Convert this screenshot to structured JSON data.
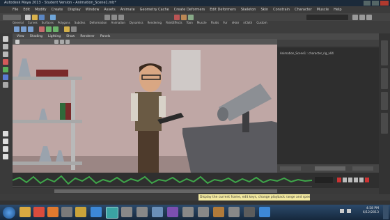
{
  "window": {
    "title": "Autodesk Maya 2013 - Student Version - Animation_Scene1.mb*"
  },
  "menubar": {
    "items": [
      "File",
      "Edit",
      "Modify",
      "Create",
      "Display",
      "Window",
      "Assets",
      "Animate",
      "Geometry Cache",
      "Create Deformers",
      "Edit Deformers",
      "Skeleton",
      "Skin",
      "Constrain",
      "Character",
      "Muscle",
      "Help"
    ]
  },
  "shelf": {
    "tabs": [
      "General",
      "Curves",
      "Surfaces",
      "Polygons",
      "Subdivs",
      "Deformation",
      "Animation",
      "Dynamics",
      "Rendering",
      "PaintEffects",
      "Toon",
      "Muscle",
      "Fluids",
      "Fur",
      "nHair",
      "nCloth",
      "Custom"
    ]
  },
  "viewport": {
    "menu": [
      "View",
      "Shading",
      "Lighting",
      "Show",
      "Renderer",
      "Panels"
    ]
  },
  "rightpanel": {
    "line": "Animation_Scene1 : character_rig_v04"
  },
  "helpline": {
    "text": "Display the current frame, edit keys, change playback range and speed... ctrl+drag frames"
  },
  "taskbar": {
    "time": "4:58 PM",
    "date": "6/12/2013"
  },
  "colors": {
    "wall": "#bfa7a5",
    "desk": "#5a5a5f",
    "waveform": "#3fa64a",
    "helpline_bg": "#f3e9a0",
    "taskbar_top": "#2c4a6b"
  }
}
